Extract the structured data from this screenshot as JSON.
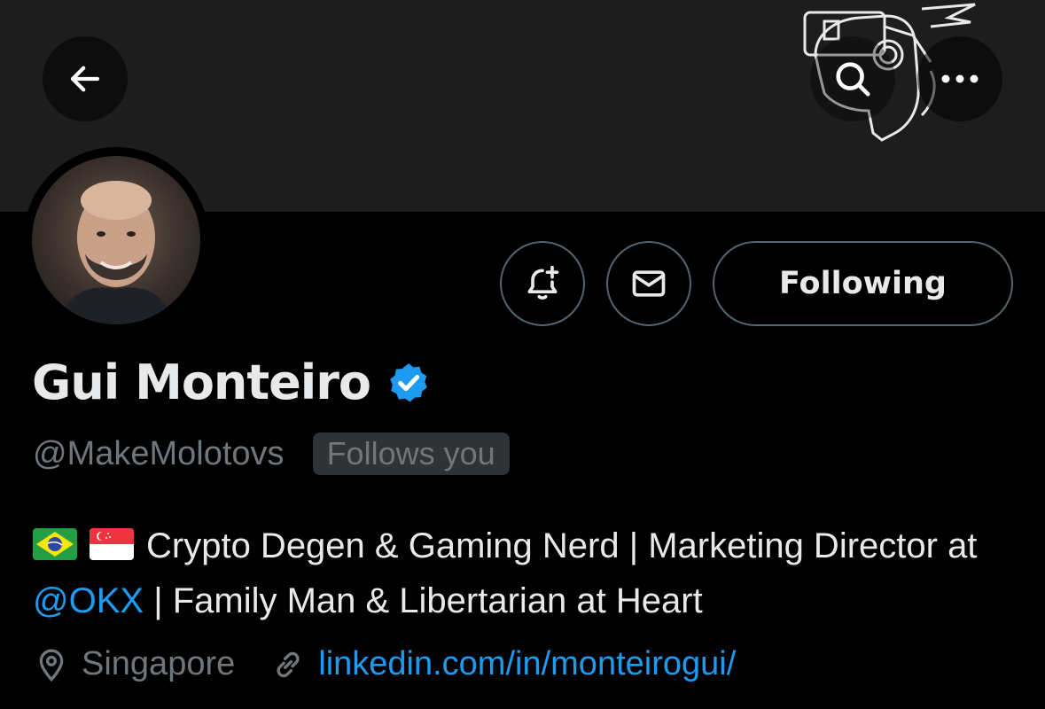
{
  "header": {
    "back_icon": "arrow-left-icon",
    "search_icon": "search-icon",
    "more_icon": "more-horizontal-icon"
  },
  "profile": {
    "display_name": "Gui Monteiro",
    "verified": true,
    "handle": "@MakeMolotovs",
    "follows_you_label": "Follows you",
    "bio_text_1": "Crypto Degen & Gaming Nerd | Marketing Director at ",
    "bio_mention": "@OKX",
    "bio_text_2": " | Family Man & Libertarian at Heart",
    "location": "Singapore",
    "website": "linkedin.com/in/monteirogui/"
  },
  "actions": {
    "notify_icon": "bell-plus-icon",
    "message_icon": "envelope-icon",
    "following_label": "Following"
  },
  "colors": {
    "background": "#000000",
    "banner": "#1d1d1d",
    "accent": "#1d9bf0",
    "secondary_text": "#71767b",
    "border": "#536471"
  }
}
